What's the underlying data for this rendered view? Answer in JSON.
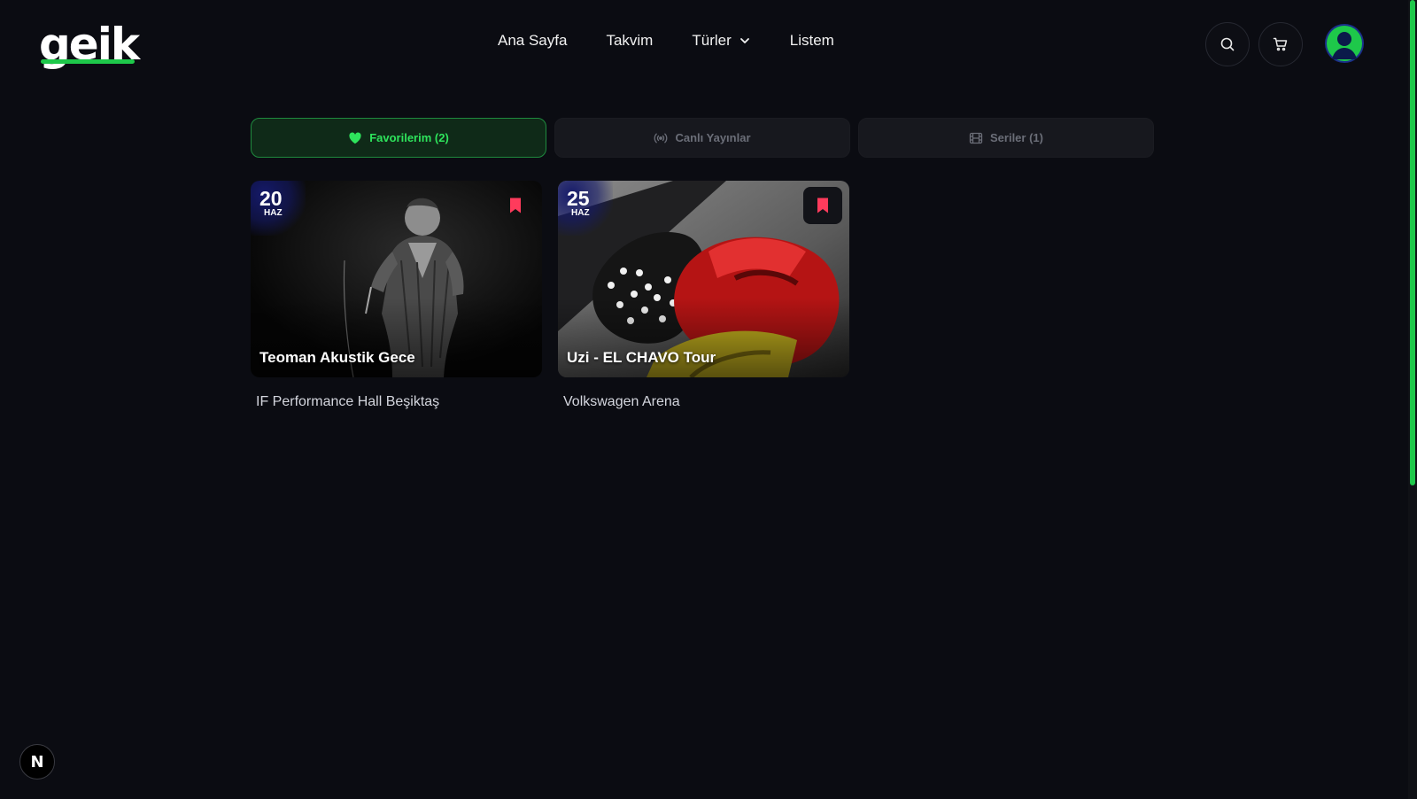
{
  "header": {
    "logo_text": "geik",
    "nav": [
      "Ana Sayfa",
      "Takvim",
      "Türler",
      "Listem"
    ],
    "search_icon": "search-icon",
    "cart_icon": "cart-icon",
    "avatar_icon": "user-avatar-icon"
  },
  "tabs": [
    {
      "label": "Favorilerim (2)",
      "icon": "heart-icon",
      "active": true
    },
    {
      "label": "Canlı Yayınlar",
      "icon": "broadcast-icon",
      "active": false
    },
    {
      "label": "Seriler (1)",
      "icon": "film-icon",
      "active": false
    }
  ],
  "events": [
    {
      "day": "20",
      "month": "HAZ",
      "title": "Teoman Akustik Gece",
      "venue": "IF Performance Hall Beşiktaş",
      "bookmarked": true
    },
    {
      "day": "25",
      "month": "HAZ",
      "title": "Uzi - EL CHAVO Tour",
      "venue": "Volkswagen Arena",
      "bookmarked": true
    }
  ],
  "next_badge": "N",
  "colors": {
    "accent": "#1ec84a",
    "bookmark": "#ff3b5c",
    "background": "#0b0c12"
  }
}
